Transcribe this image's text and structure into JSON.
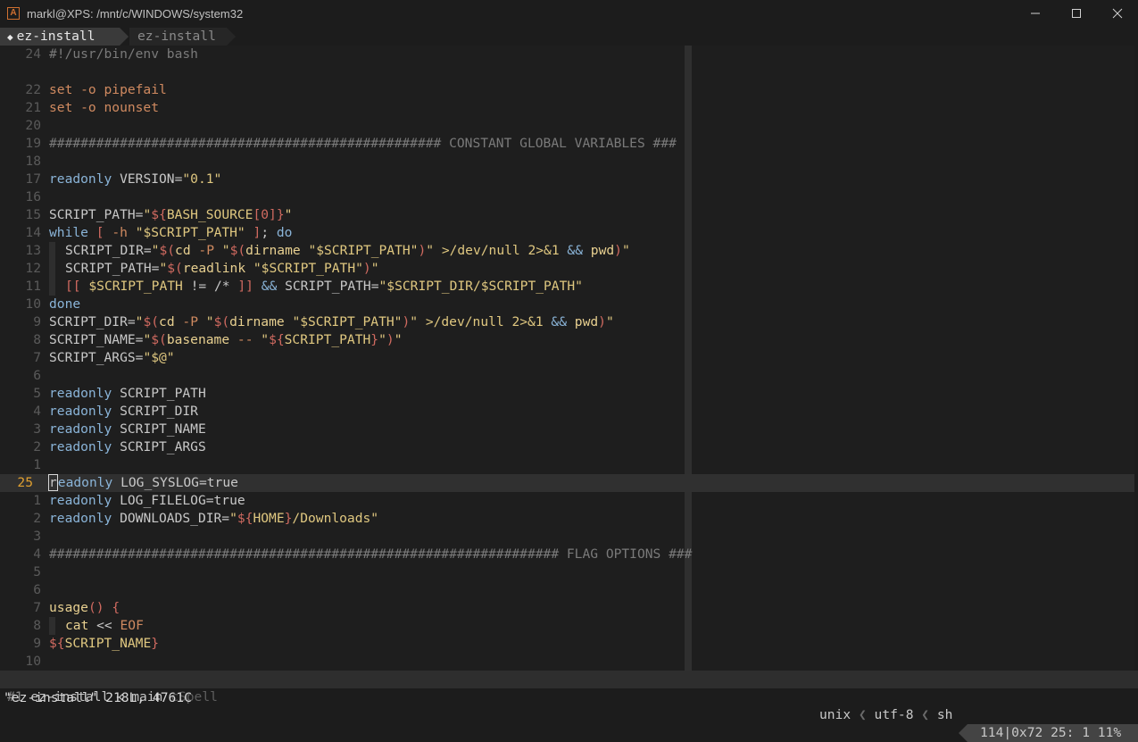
{
  "window": {
    "title": "markl@XPS: /mnt/c/WINDOWS/system32",
    "icon": "terminal-icon",
    "controls": [
      "minimize-icon",
      "maximize-icon",
      "close-icon"
    ]
  },
  "tabs": [
    {
      "label": "ez-install",
      "active": true
    },
    {
      "label": "ez-install",
      "active": false
    }
  ],
  "editor": {
    "cursor_line_number": "25",
    "lines": [
      {
        "n": "24",
        "html": "<span class='t-comment'>#!/usr/bin/env bash</span>"
      },
      {
        "n": "",
        "html": ""
      },
      {
        "n": "22",
        "html": "<span class='t-kw'>set -o pipefail</span>"
      },
      {
        "n": "21",
        "html": "<span class='t-kw'>set -o nounset</span>"
      },
      {
        "n": "20",
        "html": ""
      },
      {
        "n": "19",
        "html": "<span class='t-comment'>################################################## CONSTANT GLOBAL VARIABLES ###</span>"
      },
      {
        "n": "18",
        "html": ""
      },
      {
        "n": "17",
        "html": "<span class='t-blue'>readonly</span> VERSION=<span class='t-str'>\"0.1\"</span>"
      },
      {
        "n": "16",
        "html": ""
      },
      {
        "n": "15",
        "html": "SCRIPT_PATH=<span class='t-str'>\"<span class='t-paren'>${</span>BASH_SOURCE<span class='t-paren'>[0]}</span>\"</span>"
      },
      {
        "n": "14",
        "html": "<span class='t-blue'>while</span> <span class='t-paren'>[</span> <span class='t-kw'>-h</span> <span class='t-str'>\"$SCRIPT_PATH\"</span> <span class='t-paren'>]</span>; <span class='t-blue'>do</span>"
      },
      {
        "n": "13",
        "html": "<span class='indent'></span>SCRIPT_DIR=<span class='t-str'>\"<span class='t-paren'>$(</span><span class='t-func'>cd</span> <span class='t-kw'>-P</span> \"<span class='t-paren'>$(</span><span class='t-func'>dirname</span> \"$SCRIPT_PATH\"<span class='t-paren'>)</span>\" &gt;/dev/null 2&gt;&amp;1 <span class='t-blue'>&amp;&amp;</span> <span class='t-func'>pwd</span><span class='t-paren'>)</span>\"</span>"
      },
      {
        "n": "12",
        "html": "<span class='indent'></span>SCRIPT_PATH=<span class='t-str'>\"<span class='t-paren'>$(</span><span class='t-func'>readlink</span> \"$SCRIPT_PATH\"<span class='t-paren'>)</span>\"</span>"
      },
      {
        "n": "11",
        "html": "<span class='indent'></span><span class='t-paren'>[[</span> <span class='t-var'>$SCRIPT_PATH</span> != /* <span class='t-paren'>]]</span> <span class='t-blue'>&amp;&amp;</span> SCRIPT_PATH=<span class='t-str'>\"$SCRIPT_DIR/$SCRIPT_PATH\"</span>"
      },
      {
        "n": "10",
        "html": "<span class='t-blue'>done</span>"
      },
      {
        "n": "9",
        "html": "SCRIPT_DIR=<span class='t-str'>\"<span class='t-paren'>$(</span><span class='t-func'>cd</span> <span class='t-kw'>-P</span> \"<span class='t-paren'>$(</span><span class='t-func'>dirname</span> \"$SCRIPT_PATH\"<span class='t-paren'>)</span>\" &gt;/dev/null 2&gt;&amp;1 <span class='t-blue'>&amp;&amp;</span> <span class='t-func'>pwd</span><span class='t-paren'>)</span>\"</span>"
      },
      {
        "n": "8",
        "html": "SCRIPT_NAME=<span class='t-str'>\"<span class='t-paren'>$(</span><span class='t-func'>basename</span> <span class='t-kw'>--</span> \"<span class='t-paren'>${</span>SCRIPT_PATH<span class='t-paren'>}</span>\"<span class='t-paren'>)</span>\"</span>"
      },
      {
        "n": "7",
        "html": "SCRIPT_ARGS=<span class='t-str'>\"$@\"</span>"
      },
      {
        "n": "6",
        "html": ""
      },
      {
        "n": "5",
        "html": "<span class='t-blue'>readonly</span> SCRIPT_PATH"
      },
      {
        "n": "4",
        "html": "<span class='t-blue'>readonly</span> SCRIPT_DIR"
      },
      {
        "n": "3",
        "html": "<span class='t-blue'>readonly</span> SCRIPT_NAME"
      },
      {
        "n": "2",
        "html": "<span class='t-blue'>readonly</span> SCRIPT_ARGS"
      },
      {
        "n": "1",
        "html": ""
      },
      {
        "n": "25",
        "html": "<span class='cursor'>r</span><span class='t-blue'>eadonly</span> LOG_SYSLOG=true",
        "current": true
      },
      {
        "n": "1",
        "html": "<span class='t-blue'>readonly</span> LOG_FILELOG=true"
      },
      {
        "n": "2",
        "html": "<span class='t-blue'>readonly</span> DOWNLOADS_DIR=<span class='t-str'>\"<span class='t-paren'>${</span>HOME<span class='t-paren'>}</span>/Downloads\"</span>"
      },
      {
        "n": "3",
        "html": ""
      },
      {
        "n": "4",
        "html": "<span class='t-comment'>################################################################# FLAG OPTIONS ###</span>"
      },
      {
        "n": "5",
        "html": ""
      },
      {
        "n": "6",
        "html": ""
      },
      {
        "n": "7",
        "html": "<span class='t-func'>usage</span><span class='t-paren'>()</span> <span class='t-paren'>{</span>"
      },
      {
        "n": "8",
        "html": "<span class='indent'></span><span class='t-func'>cat</span> &lt;&lt; <span class='t-kw'>EOF</span>"
      },
      {
        "n": "9",
        "html": "<span class='t-str'><span class='t-paren'>${</span>SCRIPT_NAME<span class='t-paren'>}</span></span>"
      },
      {
        "n": "10",
        "html": ""
      }
    ]
  },
  "status": {
    "buffer_num": "#1",
    "file": "ez-install",
    "branch_icon": "git-branch-icon",
    "branch": "main",
    "spell": "cSpell",
    "fileformat": "unix",
    "encoding": "utf-8",
    "filetype": "sh",
    "position": "114|0x72 25: 1 11%"
  },
  "cmdline": "\"ez-install\" 218L, 4761C"
}
